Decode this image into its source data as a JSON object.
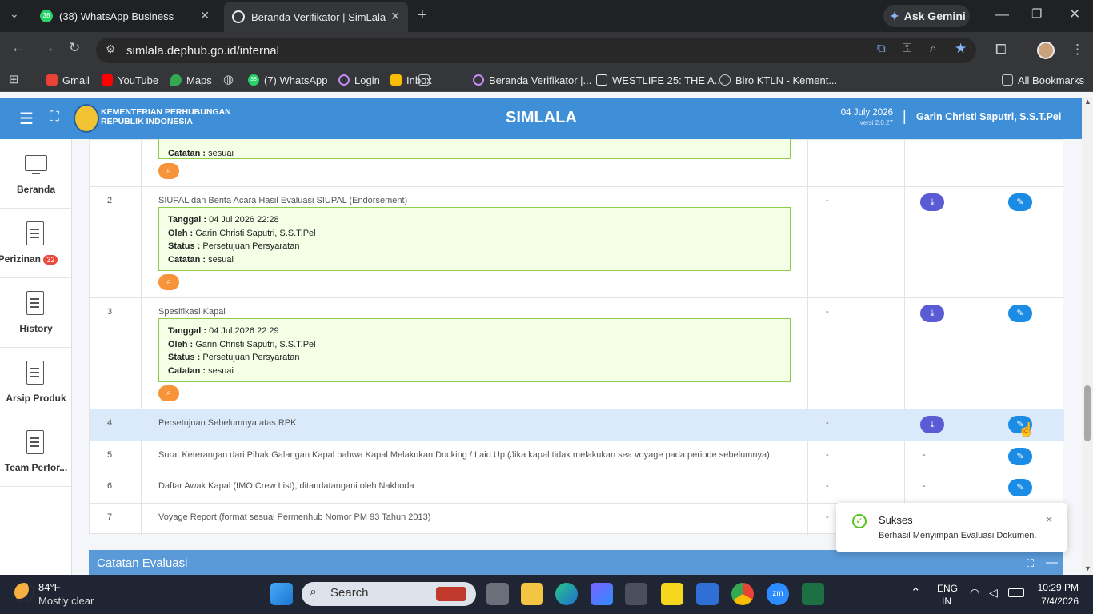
{
  "browser": {
    "tabs": [
      {
        "title": "(38) WhatsApp Business",
        "badge": "38"
      },
      {
        "title": "Beranda Verifikator | SimLala"
      }
    ],
    "new_tab": "+",
    "ask_gemini": "Ask Gemini",
    "url": "simlala.dephub.go.id/internal",
    "bookmarks": [
      "Gmail",
      "YouTube",
      "Maps",
      "(7) WhatsApp",
      "Login",
      "Inbox",
      "Beranda Verifikator |...",
      "WESTLIFE 25: THE A...",
      "Biro KTLN - Kement..."
    ],
    "bookmark_badge": "38",
    "all_bookmarks": "All Bookmarks"
  },
  "header": {
    "org_line1": "KEMENTERIAN PERHUBUNGAN",
    "org_line2": "REPUBLIK INDONESIA",
    "app_name": "SIMLALA",
    "date": "04 July 2026",
    "version": "versi 2.0.27",
    "separator": "|",
    "user": "Garin Christi Saputri, S.S.T.Pel"
  },
  "sidebar": {
    "items": [
      {
        "label": "Beranda"
      },
      {
        "label": "Perizinan",
        "badge": "32"
      },
      {
        "label": "History"
      },
      {
        "label": "Arsip Produk"
      },
      {
        "label": "Team Perfor..."
      }
    ]
  },
  "table": {
    "top_partial": {
      "catatan_label": "Catatan :",
      "catatan_value": "sesuai"
    },
    "rows": [
      {
        "no": "2",
        "doc": "SIUPAL dan Berita Acara Hasil Evaluasi SIUPAL (Endorsement)",
        "dash": "-",
        "eval": {
          "tanggal_label": "Tanggal :",
          "tanggal": "04 Jul 2026 22:28",
          "oleh_label": "Oleh :",
          "oleh": "Garin Christi Saputri, S.S.T.Pel",
          "status_label": "Status :",
          "status": "Persetujuan Persyaratan",
          "catatan_label": "Catatan :",
          "catatan": "sesuai"
        }
      },
      {
        "no": "3",
        "doc": "Spesifikasi Kapal",
        "dash": "-",
        "eval": {
          "tanggal_label": "Tanggal :",
          "tanggal": "04 Jul 2026 22:29",
          "oleh_label": "Oleh :",
          "oleh": "Garin Christi Saputri, S.S.T.Pel",
          "status_label": "Status :",
          "status": "Persetujuan Persyaratan",
          "catatan_label": "Catatan :",
          "catatan": "sesuai"
        }
      },
      {
        "no": "4",
        "doc": "Persetujuan Sebelumnya atas RPK",
        "dash": "-"
      },
      {
        "no": "5",
        "doc": "Surat Keterangan dari Pihak Galangan Kapal bahwa Kapal Melakukan Docking / Laid Up (Jika kapal tidak melakukan sea voyage pada periode sebelumnya)",
        "dash": "-",
        "dash2": "-"
      },
      {
        "no": "6",
        "doc": "Daftar Awak Kapal (IMO Crew List), ditandatangani oleh Nakhoda",
        "dash": "-",
        "dash2": "-"
      },
      {
        "no": "7",
        "doc": "Voyage Report (format sesuai Permenhub Nomor PM 93 Tahun 2013)",
        "dash": "-"
      }
    ]
  },
  "catatan_evaluasi": {
    "title": "Catatan Evaluasi"
  },
  "toast": {
    "title": "Sukses",
    "message": "Berhasil Menyimpan Evaluasi Dokumen."
  },
  "taskbar": {
    "weather_temp": "84°F",
    "weather_desc": "Mostly clear",
    "search": "Search",
    "lang1": "ENG",
    "lang2": "IN",
    "time": "10:29 PM",
    "date": "7/4/2026"
  },
  "colors": {
    "header_blue": "#3e8ed8",
    "edit_blue": "#1b8ce5",
    "download_purple": "#5c5bd6",
    "search_orange": "#f7943a",
    "eval_green_border": "#8ccd4b",
    "highlight_row": "#dbeafb"
  }
}
